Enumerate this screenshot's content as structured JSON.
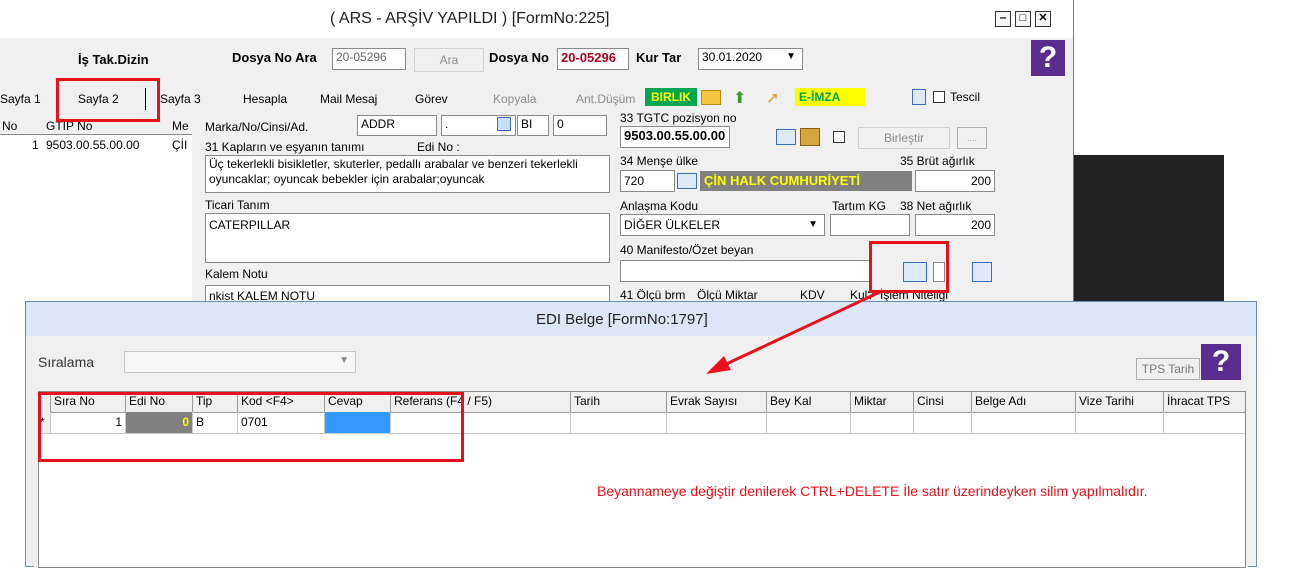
{
  "main_window": {
    "title": "( ARS - ARŞİV YAPILDI ) [FormNo:225]",
    "header": {
      "is_takip_dizin": "İş Tak.Dizin",
      "dosya_no_ara_label": "Dosya No Ara",
      "dosya_no_ara_value": "20-05296",
      "ara_button": "Ara",
      "dosya_no_label": "Dosya No",
      "dosya_no_value": "20-05296",
      "kur_tar_label": "Kur Tar",
      "kur_tar_value": "30.01.2020"
    },
    "tabs": [
      "Sayfa 1",
      "Sayfa 2",
      "Sayfa 3",
      "Hesapla",
      "Mail Mesaj",
      "Görev",
      "Kopyala",
      "Ant.Düşüm"
    ],
    "birlik_badge": "BIRLIK",
    "e_imza_badge": "E-İMZA",
    "tescil_label": "Tescil",
    "left_grid": {
      "headers": [
        "No",
        "GTIP No",
        "Me"
      ],
      "row": {
        "no": "1",
        "gtip": "9503.00.55.00.00",
        "me": "ÇİI"
      }
    },
    "form": {
      "marka_label": "Marka/No/Cinsi/Ad.",
      "marka_value": "ADDR",
      "marka_extra": ".",
      "bi_label": "BI",
      "bi_value": "0",
      "kaplar_label": "31 Kapların ve eşyanın tanımı",
      "edi_no_label": "Edi No :",
      "tanim_text": "Üç tekerlekli bisikletler, skuterler, pedallı arabalar ve benzeri tekerlekli oyuncaklar; oyuncak bebekler için arabalar;oyuncak",
      "ticari_tanim_label": "Ticari Tanım",
      "ticari_tanim_value": "CATERPILLAR",
      "kalem_notu_label": "Kalem Notu",
      "kalem_notu_value": "nkist KALEM NOTU",
      "tgtc_label": "33 TGTC pozisyon no",
      "tgtc_value": "9503.00.55.00.00",
      "birlestir_button": "Birleştir",
      "mense_label": "34 Menşe ülke",
      "mense_code": "720",
      "mense_name": "ÇİN HALK CUMHURİYETİ",
      "brut_label": "35 Brüt ağırlık",
      "brut_value": "200",
      "anlasma_label": "Anlaşma Kodu",
      "anlasma_value": "DİĞER ÜLKELER",
      "tartim_label": "Tartım KG",
      "net_label": "38 Net ağırlık",
      "net_value": "200",
      "manifesto_label": "40 Manifesto/Özet beyan",
      "olcu_row": [
        "41 Ölçü brm",
        "Ölçü Miktar",
        "KDV",
        "Kul?",
        "İşlem Niteliği"
      ]
    }
  },
  "edi_window": {
    "title": "EDI Belge  [FormNo:1797]",
    "siralama_label": "Sıralama",
    "tps_tarih_button": "TPS Tarih",
    "grid_headers": [
      "Sıra No",
      "Edi No",
      "Tip",
      "Kod <F4>",
      "Cevap",
      "Referans (F4 / F5)",
      "Tarih",
      "Evrak Sayısı",
      "Bey Kal",
      "Miktar",
      "Cinsi",
      "Belge Adı",
      "Vize Tarihi",
      "İhracat TPS"
    ],
    "grid_row": {
      "marker": "*",
      "sira_no": "1",
      "edi_no": "0",
      "tip": "B",
      "kod": "0701",
      "cevap": ""
    }
  },
  "annotation": {
    "text": "Beyannameye değiştir denilerek CTRL+DELETE İle satır üzerindeyken silim yapılmalıdır.",
    "color": "#e8101a"
  }
}
